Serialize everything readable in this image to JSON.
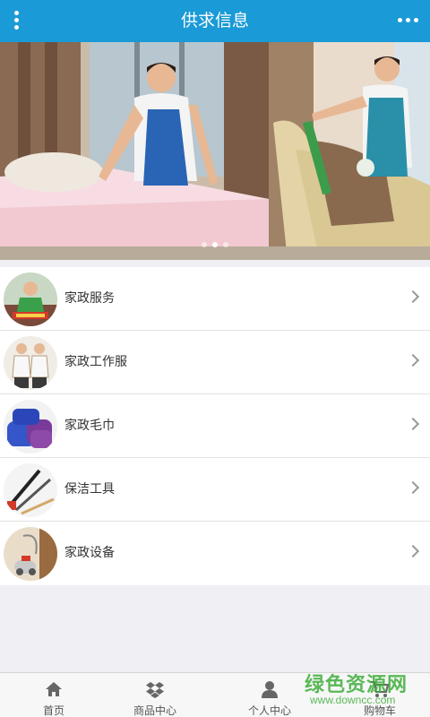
{
  "header": {
    "title": "供求信息",
    "menu_icon": "vertical-dots-icon",
    "more_icon": "horizontal-dots-icon"
  },
  "banner": {
    "slide_count": 3,
    "active_slide": 2
  },
  "categories": [
    {
      "label": "家政服务"
    },
    {
      "label": "家政工作服"
    },
    {
      "label": "家政毛巾"
    },
    {
      "label": "保洁工具"
    },
    {
      "label": "家政设备"
    }
  ],
  "tabbar": {
    "items": [
      {
        "label": "首页",
        "icon": "home-icon"
      },
      {
        "label": "商品中心",
        "icon": "dropbox-icon"
      },
      {
        "label": "个人中心",
        "icon": "user-icon"
      },
      {
        "label": "购物车",
        "icon": "cart-icon"
      }
    ]
  },
  "watermark": {
    "title": "绿色资源网",
    "url": "www.downcc.com"
  },
  "colors": {
    "header_bg": "#1a9ad6",
    "page_bg": "#efeff4",
    "watermark": "#3fae3c"
  }
}
